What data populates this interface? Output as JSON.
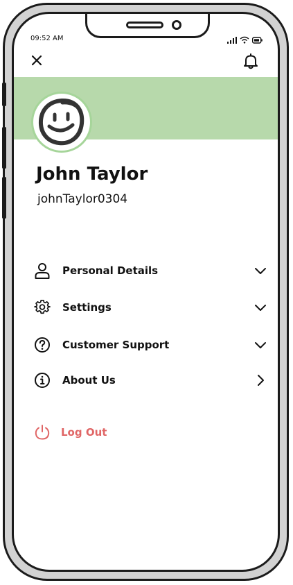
{
  "status_bar": {
    "time": "09:52 AM"
  },
  "header": {
    "close_icon": "close-icon",
    "notification_icon": "bell-icon"
  },
  "profile": {
    "name": "John Taylor",
    "username": "johnTaylor0304",
    "avatar_icon": "smiley-face-icon",
    "banner_color": "#b7d9ab"
  },
  "menu": {
    "items": [
      {
        "label": "Personal Details",
        "icon": "user-icon",
        "chevron": "chevron-down-icon"
      },
      {
        "label": "Settings",
        "icon": "gear-icon",
        "chevron": "chevron-down-icon"
      },
      {
        "label": "Customer Support",
        "icon": "question-circle-icon",
        "chevron": "chevron-down-icon"
      },
      {
        "label": "About Us",
        "icon": "info-circle-icon",
        "chevron": "chevron-right-icon"
      }
    ],
    "logout": {
      "label": "Log Out",
      "icon": "power-icon",
      "color": "#e06666"
    }
  }
}
